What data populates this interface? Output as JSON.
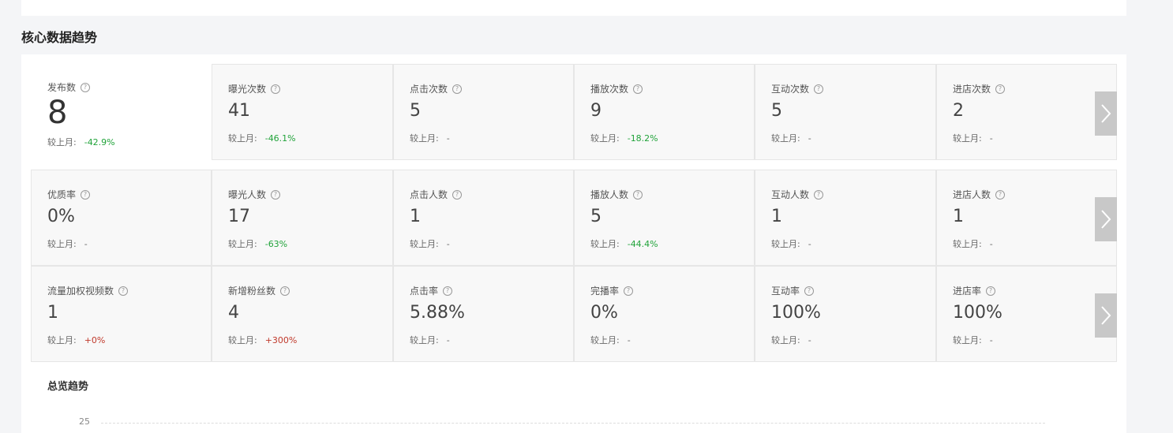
{
  "section_title": "核心数据趋势",
  "help_icon_glyph": "?",
  "compare_label": "较上月:",
  "rows": [
    [
      {
        "label": "发布数",
        "value": "8",
        "delta": "-42.9%",
        "trend": "down"
      },
      {
        "label": "曝光次数",
        "value": "41",
        "delta": "-46.1%",
        "trend": "down"
      },
      {
        "label": "点击次数",
        "value": "5",
        "delta": "-",
        "trend": "flat"
      },
      {
        "label": "播放次数",
        "value": "9",
        "delta": "-18.2%",
        "trend": "down"
      },
      {
        "label": "互动次数",
        "value": "5",
        "delta": "-",
        "trend": "flat"
      },
      {
        "label": "进店次数",
        "value": "2",
        "delta": "-",
        "trend": "flat"
      }
    ],
    [
      {
        "label": "优质率",
        "value": "0%",
        "delta": "-",
        "trend": "flat"
      },
      {
        "label": "曝光人数",
        "value": "17",
        "delta": "-63%",
        "trend": "down"
      },
      {
        "label": "点击人数",
        "value": "1",
        "delta": "-",
        "trend": "flat"
      },
      {
        "label": "播放人数",
        "value": "5",
        "delta": "-44.4%",
        "trend": "down"
      },
      {
        "label": "互动人数",
        "value": "1",
        "delta": "-",
        "trend": "flat"
      },
      {
        "label": "进店人数",
        "value": "1",
        "delta": "-",
        "trend": "flat"
      }
    ],
    [
      {
        "label": "流量加权视频数",
        "value": "1",
        "delta": "+0%",
        "trend": "up"
      },
      {
        "label": "新增粉丝数",
        "value": "4",
        "delta": "+300%",
        "trend": "up"
      },
      {
        "label": "点击率",
        "value": "5.88%",
        "delta": "-",
        "trend": "flat"
      },
      {
        "label": "完播率",
        "value": "0%",
        "delta": "-",
        "trend": "flat"
      },
      {
        "label": "互动率",
        "value": "100%",
        "delta": "-",
        "trend": "flat"
      },
      {
        "label": "进店率",
        "value": "100%",
        "delta": "-",
        "trend": "flat"
      }
    ]
  ],
  "overview": {
    "title": "总览趋势",
    "y_tick_top": "25"
  },
  "colors": {
    "trend_down": "#21a33a",
    "trend_up": "#c0392b"
  },
  "icons": {
    "help": "question-circle-icon",
    "next": "chevron-right-icon"
  }
}
